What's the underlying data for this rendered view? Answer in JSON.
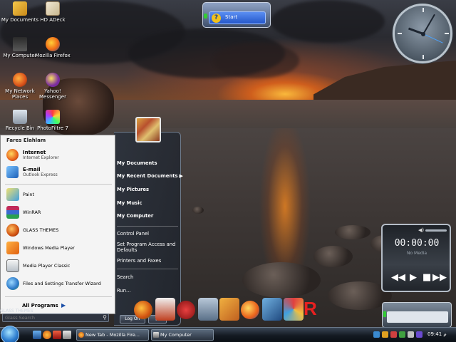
{
  "desktop": {
    "icons": [
      {
        "label": "My Documents",
        "icon": "my-documents-icon"
      },
      {
        "label": "HD ADeck",
        "icon": "hd-adeck-icon"
      },
      {
        "label": "My Computer",
        "icon": "my-computer-icon"
      },
      {
        "label": "Mozilla Firefox",
        "icon": "firefox-icon"
      },
      {
        "label": "My Network Places",
        "icon": "network-places-icon"
      },
      {
        "label": "Yahoo! Messenger",
        "icon": "yahoo-messenger-icon"
      },
      {
        "label": "Recycle Bin",
        "icon": "recycle-bin-icon"
      },
      {
        "label": "PhotoFiltre 7",
        "icon": "photofiltre-icon"
      }
    ]
  },
  "search_gadget": {
    "label": "Start"
  },
  "start_menu": {
    "username": "Fares Elahlam",
    "pinned": [
      {
        "title": "Internet",
        "subtitle": "Internet Explorer"
      },
      {
        "title": "E-mail",
        "subtitle": "Outlook Express"
      }
    ],
    "programs": [
      "Paint",
      "WinRAR",
      "GLASS THEMES",
      "Windows Media Player",
      "Media Player Classic",
      "Files and Settings Transfer Wizard"
    ],
    "all_programs": "All Programs",
    "right_items": [
      "My Documents",
      "My Recent Documents",
      "My Pictures",
      "My Music",
      "My Computer"
    ],
    "right_system": [
      "Control Panel",
      "Set Program Access and Defaults",
      "Printers and Faxes"
    ],
    "right_bottom": [
      "Search",
      "Run..."
    ],
    "search_placeholder": "Glass Search",
    "glass_label": "GLASS THEMES",
    "log_off": "Log Off"
  },
  "media_gadget": {
    "time": "00:00:00",
    "track": "No Media"
  },
  "taskbar": {
    "tasks": [
      "New Tab - Mozilla Fire...",
      "My Computer"
    ],
    "clock": "09:41 م"
  },
  "colors": {
    "accent": "#2f7fd0",
    "menu_bg": "#f4f4f4",
    "taskbar": "#141a22"
  }
}
